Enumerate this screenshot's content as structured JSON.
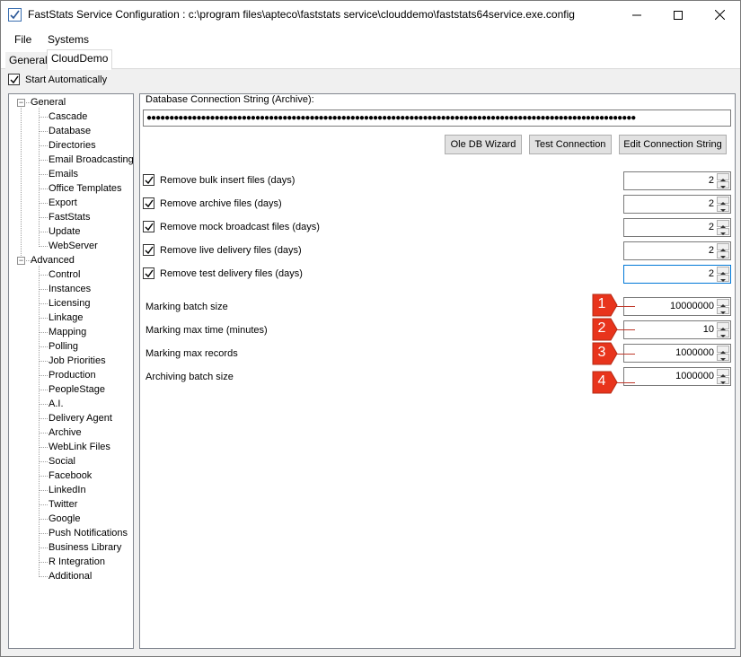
{
  "window": {
    "title": "FastStats Service Configuration : c:\\program files\\apteco\\faststats service\\clouddemo\\faststats64service.exe.config"
  },
  "menu": [
    "File",
    "Systems"
  ],
  "tabs": [
    "General",
    "CloudDemo"
  ],
  "start_automatically": {
    "label": "Start Automatically",
    "checked": true
  },
  "tree": {
    "general": {
      "label": "General",
      "items": [
        "Cascade",
        "Database",
        "Directories",
        "Email Broadcasting",
        "Emails",
        "Office Templates",
        "Export",
        "FastStats",
        "Update",
        "WebServer"
      ]
    },
    "advanced": {
      "label": "Advanced",
      "items": [
        "Control",
        "Instances",
        "Licensing",
        "Linkage",
        "Mapping",
        "Polling",
        "Job Priorities",
        "Production",
        "PeopleStage",
        "A.I.",
        "Delivery Agent",
        "Archive",
        "WebLink Files",
        "Social",
        "Facebook",
        "LinkedIn",
        "Twitter",
        "Google",
        "Push Notifications",
        "Business Library",
        "R Integration",
        "Additional"
      ]
    }
  },
  "database": {
    "conn_label": "Database Connection String (Archive):",
    "conn_value": "●●●●●●●●●●●●●●●●●●●●●●●●●●●●●●●●●●●●●●●●●●●●●●●●●●●●●●●●●●●●●●●●●●●●●●●●●●●●●●●●●●●●●●●●●●●●●●●●●●●●●●●●●●●●",
    "buttons": {
      "ole_db": "Ole DB Wizard",
      "test": "Test Connection",
      "edit": "Edit Connection String"
    }
  },
  "file_options": [
    {
      "label": "Remove bulk insert files (days)",
      "value": "2",
      "checked": true
    },
    {
      "label": "Remove archive files (days)",
      "value": "2",
      "checked": true
    },
    {
      "label": "Remove mock broadcast files (days)",
      "value": "2",
      "checked": true
    },
    {
      "label": "Remove live delivery files (days)",
      "value": "2",
      "checked": true
    },
    {
      "label": "Remove test delivery files (days)",
      "value": "2",
      "checked": true
    }
  ],
  "numeric_options": [
    {
      "label": "Marking batch size",
      "value": "10000000",
      "callout": "1"
    },
    {
      "label": "Marking max time (minutes)",
      "value": "10",
      "callout": "2"
    },
    {
      "label": "Marking max records",
      "value": "1000000",
      "callout": "3"
    },
    {
      "label": "Archiving batch size",
      "value": "1000000",
      "callout": "4"
    }
  ],
  "colors": {
    "callout": "#e8341c",
    "accent": "#0078d7"
  }
}
